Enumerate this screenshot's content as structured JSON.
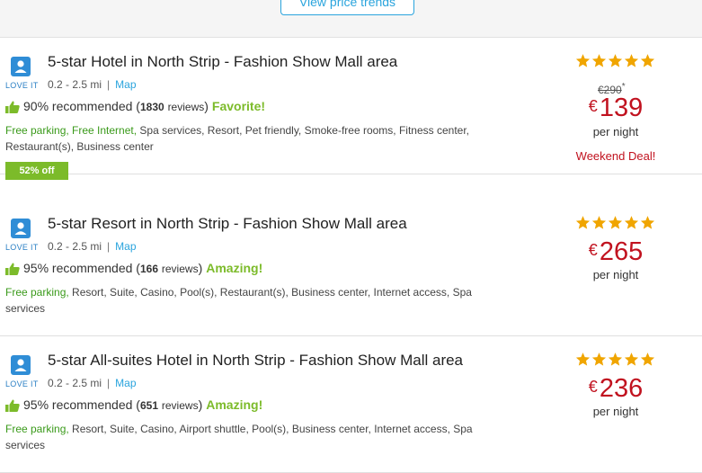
{
  "header": {
    "trend_button": "View price trends"
  },
  "labels": {
    "love_it": "LOVE IT",
    "map": "Map",
    "per_night": "per night"
  },
  "colors": {
    "accent_blue": "#2aa4dd",
    "price_red": "#c1121f",
    "praise_green": "#7cbb2a",
    "star_gold": "#f0a500"
  },
  "listings": [
    {
      "title": "5-star Hotel in North Strip - Fashion Show Mall area",
      "distance": "0.2 - 2.5 mi",
      "recommended": "90% recommended",
      "reviews_count": "1830",
      "reviews_label": "reviews",
      "praise": "Favorite!",
      "amenities_highlight": "Free parking, Free Internet,",
      "amenities_rest": "Spa services, Resort, Pet friendly, Smoke-free rooms, Fitness center, Restaurant(s), Business center",
      "badge": "52% off",
      "stars": 5,
      "old_price": "€290",
      "old_price_mark": "*",
      "currency": "€",
      "price": "139",
      "deal_text": "Weekend Deal!"
    },
    {
      "title": "5-star Resort in North Strip - Fashion Show Mall area",
      "distance": "0.2 - 2.5 mi",
      "recommended": "95% recommended",
      "reviews_count": "166",
      "reviews_label": "reviews",
      "praise": "Amazing!",
      "amenities_highlight": "Free parking,",
      "amenities_rest": "Resort, Suite, Casino, Pool(s), Restaurant(s), Business center, Internet access, Spa services",
      "stars": 5,
      "currency": "€",
      "price": "265"
    },
    {
      "title": "5-star All-suites Hotel in North Strip - Fashion Show Mall area",
      "distance": "0.2 - 2.5 mi",
      "recommended": "95% recommended",
      "reviews_count": "651",
      "reviews_label": "reviews",
      "praise": "Amazing!",
      "amenities_highlight": "Free parking,",
      "amenities_rest": "Resort, Suite, Casino, Airport shuttle, Pool(s), Business center, Internet access, Spa services",
      "stars": 5,
      "currency": "€",
      "price": "236"
    }
  ]
}
